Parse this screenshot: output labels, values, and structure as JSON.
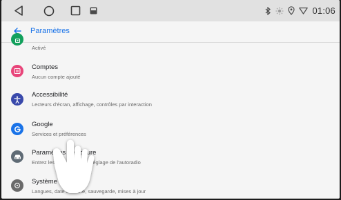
{
  "status_bar": {
    "clock": "01:06",
    "icons": [
      "bluetooth-icon",
      "brightness-icon",
      "location-icon",
      "wifi-icon"
    ]
  },
  "nav_buttons": [
    "back-triangle-icon",
    "home-circle-icon",
    "recents-square-icon",
    "media-icon"
  ],
  "app_bar": {
    "title": "Paramètres"
  },
  "settings": [
    {
      "title": "",
      "subtitle": "Activé",
      "icon": "lock-icon",
      "color": "#12a05c"
    },
    {
      "title": "Comptes",
      "subtitle": "Aucun compte ajouté",
      "icon": "accounts-icon",
      "color": "#e8457a"
    },
    {
      "title": "Accessibilité",
      "subtitle": "Lecteurs d'écran, affichage, contrôles par interaction",
      "icon": "accessibility-icon",
      "color": "#3949ab"
    },
    {
      "title": "Google",
      "subtitle": "Services et préférences",
      "icon": "google-icon",
      "color": "#1a73e8"
    },
    {
      "title": "Paramètres de voiture",
      "subtitle": "Entrez les paramètres de réglage de l'autoradio",
      "icon": "car-icon",
      "color": "#5f6b75"
    },
    {
      "title": "Système",
      "subtitle": "Langues, date et heure, sauvegarde, mises à jour",
      "icon": "info-icon",
      "color": "#6a6a6a"
    }
  ]
}
